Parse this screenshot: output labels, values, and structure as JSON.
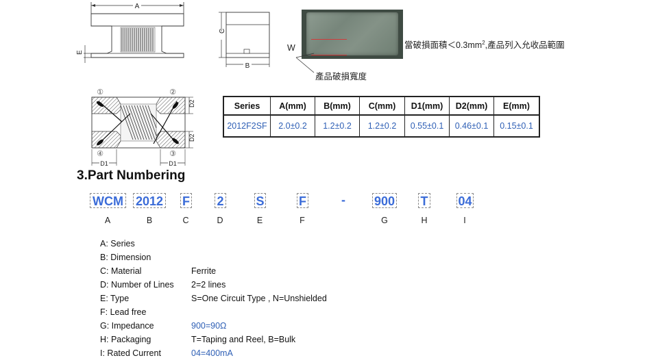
{
  "diagram": {
    "dim_A": "A",
    "dim_B": "B",
    "dim_C": "C",
    "dim_E": "E",
    "dim_W": "W",
    "pad_1": "①",
    "pad_2": "②",
    "pad_3": "③",
    "pad_4": "④",
    "dim_D1": "D1",
    "dim_D2": "D2"
  },
  "notes": {
    "damage_rule_prefix": "當破損面積＜0.3mm",
    "damage_rule_sup": "2",
    "damage_rule_suffix": ",產品列入允收品範圍",
    "damage_width_label": "產品破損寬度"
  },
  "spec_table": {
    "headers": [
      "Series",
      "A(mm)",
      "B(mm)",
      "C(mm)",
      "D1(mm)",
      "D2(mm)",
      "E(mm)"
    ],
    "rows": [
      [
        "2012F2SF",
        "2.0±0.2",
        "1.2±0.2",
        "1.2±0.2",
        "0.55±0.1",
        "0.46±0.1",
        "0.15±0.1"
      ]
    ]
  },
  "part_numbering": {
    "title": "3.Part Numbering",
    "segments": [
      {
        "code": "WCM",
        "letter": "A"
      },
      {
        "code": "2012",
        "letter": "B"
      },
      {
        "code": "F",
        "letter": "C"
      },
      {
        "code": "2",
        "letter": "D"
      },
      {
        "code": "S",
        "letter": "E"
      },
      {
        "code": "F",
        "letter": "F"
      },
      {
        "code": "-",
        "letter": ""
      },
      {
        "code": "900",
        "letter": "G"
      },
      {
        "code": "T",
        "letter": "H"
      },
      {
        "code": "04",
        "letter": "I"
      }
    ]
  },
  "definitions": [
    {
      "label": "A: Series",
      "value": ""
    },
    {
      "label": "B: Dimension",
      "value": ""
    },
    {
      "label": "C: Material",
      "value": "Ferrite"
    },
    {
      "label": "D: Number of Lines",
      "value": "2=2 lines"
    },
    {
      "label": "E: Type",
      "value": "S=One Circuit Type , N=Unshielded"
    },
    {
      "label": "F: Lead free",
      "value": ""
    },
    {
      "label": "G: Impedance",
      "value": "900=90Ω"
    },
    {
      "label": "H: Packaging",
      "value": "T=Taping and Reel, B=Bulk"
    },
    {
      "label": "I: Rated Current",
      "value": "04=400mA"
    }
  ]
}
